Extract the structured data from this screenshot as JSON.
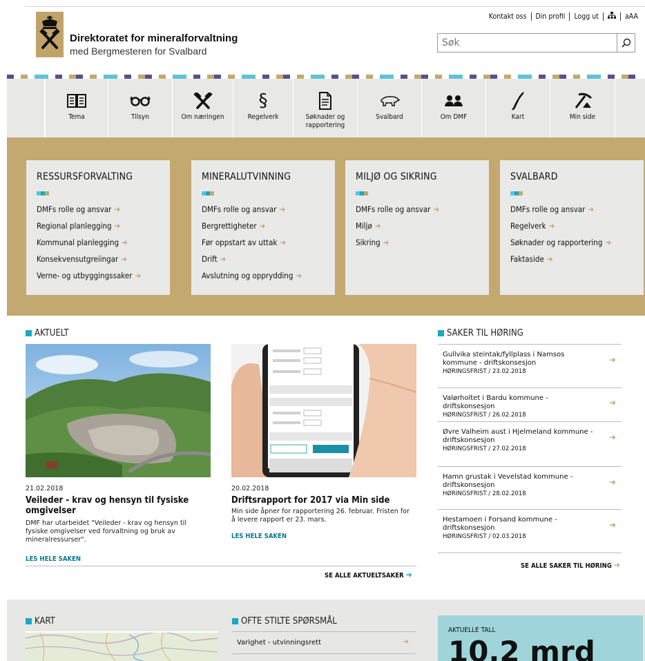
{
  "header": {
    "org_name": "Direktoratet for mineralforvaltning",
    "org_sub": "med Bergmesteren for Svalbard",
    "links": [
      "Kontakt oss",
      "Din profil",
      "Logg ut",
      "aAA"
    ],
    "search_placeholder": "Søk"
  },
  "colors": {
    "gold": "#c3a86f",
    "teal": "#1aa8c5",
    "nav_bg": "#e8e8e6",
    "stripe_dark": "#5a4f8a",
    "stripe_gold": "#c3a86f",
    "stripe_teal": "#5ec3d6",
    "tall_bg": "#9fd5da"
  },
  "nav": [
    {
      "label": "Tema",
      "icon": "book-icon"
    },
    {
      "label": "Tilsyn",
      "icon": "glasses-icon"
    },
    {
      "label": "Om næringen",
      "icon": "hammers-icon"
    },
    {
      "label": "Regelverk",
      "icon": "paragraph-icon"
    },
    {
      "label": "Søknader og rapportering",
      "icon": "document-icon"
    },
    {
      "label": "Svalbard",
      "icon": "polar-bear-icon"
    },
    {
      "label": "Om DMF",
      "icon": "people-icon"
    },
    {
      "label": "Kart",
      "icon": "norway-map-icon"
    },
    {
      "label": "Min side",
      "icon": "pickaxe-icon"
    }
  ],
  "cards": [
    {
      "title": "RESSURSFORVALTING",
      "links": [
        "DMFs rolle og ansvar",
        "Regional planlegging",
        "Kommunal planlegging",
        "Konsekvensutgreiingar",
        "Verne- og utbyggingssaker"
      ]
    },
    {
      "title": "MINERALUTVINNING",
      "links": [
        "DMFs rolle og ansvar",
        "Bergrettigheter",
        "Før oppstart av uttak",
        "Drift",
        "Avslutning og opprydding"
      ]
    },
    {
      "title": "MILJØ OG SIKRING",
      "links": [
        "DMFs rolle og ansvar",
        "Miljø",
        "Sikring"
      ]
    },
    {
      "title": "SVALBARD",
      "links": [
        "DMFs rolle og ansvar",
        "Regelverk",
        "Søknader og rapportering",
        "Faktaside"
      ]
    }
  ],
  "aktuelt": {
    "heading": "AKTUELT",
    "items": [
      {
        "date": "21.02.2018",
        "title": "Veileder - krav og hensyn til fysiske omgivelser",
        "text": "DMF har utarbeidet \"Veileder - krav og hensyn til fysiske omgivelser ved forvaltning og bruk av mineralressurser\".",
        "more": "LES HELE SAKEN"
      },
      {
        "date": "20.02.2018",
        "title": "Driftsrapport for 2017 via Min side",
        "text": "Min side åpner for rapportering 26. februar. Fristen for å levere rapport er 23. mars.",
        "more": "LES HELE SAKEN"
      }
    ],
    "see_all": "SE ALLE AKTUELTSAKER"
  },
  "horing": {
    "heading": "SAKER TIL HØRING",
    "items": [
      {
        "title": "Gullvika steintak/fyllplass i Namsos kommune - driftskonsesjon",
        "date": "HØRINGSFRIST / 23.02.2018"
      },
      {
        "title": "Valørholtet i Bardu kommune - driftskonsesjon",
        "date": "HØRINGSFRIST / 26.02.2018"
      },
      {
        "title": "Øvre Valheim aust i Hjelmeland kommune - driftskonsesjon",
        "date": "HØRINGSFRIST / 27.02.2018"
      },
      {
        "title": "Hamn grustak i Vevelstad kommune - driftskonsesjon",
        "date": "HØRINGSFRIST / 28.02.2018"
      },
      {
        "title": "Hestamoen i Forsand kommune - driftskonsesjon",
        "date": "HØRINGSFRIST / 02.03.2018"
      }
    ],
    "see_all": "SE ALLE SAKER TIL HØRING"
  },
  "kart": {
    "heading": "KART"
  },
  "faq": {
    "heading": "OFTE STILTE SPØRSMÅL",
    "items": [
      "Varighet - utvinningsrett"
    ]
  },
  "tall": {
    "label": "AKTUELLE TALL",
    "value": "10,2 mrd"
  }
}
